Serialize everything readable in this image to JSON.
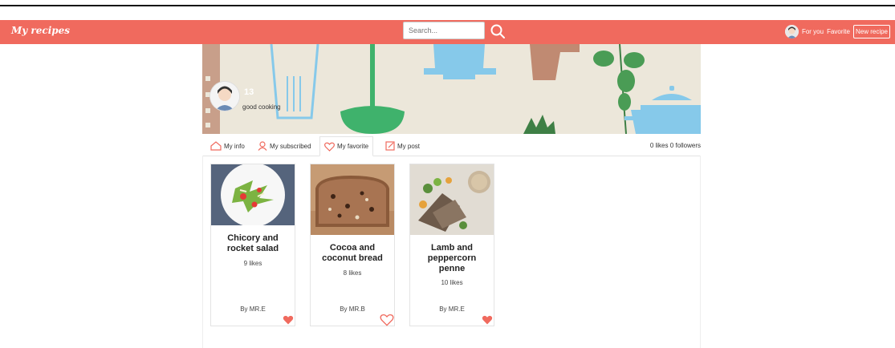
{
  "header": {
    "brand": "My recipes",
    "search_placeholder": "Search...",
    "nav": {
      "for_you": "For you",
      "favorite": "Favorite",
      "new_recipe": "New recipe"
    }
  },
  "profile": {
    "name": "13",
    "bio": "good cooking"
  },
  "tabs": [
    {
      "label": "My info",
      "icon": "home-icon"
    },
    {
      "label": "My subscribed",
      "icon": "user-icon"
    },
    {
      "label": "My favorite",
      "icon": "heart-outline-icon",
      "active": true
    },
    {
      "label": "My post",
      "icon": "edit-icon"
    }
  ],
  "stats": {
    "likes": "0 likes",
    "followers": "0 followers"
  },
  "recipes": [
    {
      "title": "Chicory and rocket salad",
      "likes": "9 likes",
      "author": "By MR.E",
      "favorited": true
    },
    {
      "title": "Cocoa and coconut bread",
      "likes": "8 likes",
      "author": "By MR.B",
      "favorited": false
    },
    {
      "title": "Lamb and peppercorn penne",
      "likes": "10 likes",
      "author": "By MR.E",
      "favorited": true
    }
  ],
  "colors": {
    "accent": "#f06a5e",
    "banner_bg": "#ece7da",
    "utensil_blue": "#86c9ea",
    "utensil_green": "#3fb26c",
    "utensil_brown": "#c08a72"
  }
}
